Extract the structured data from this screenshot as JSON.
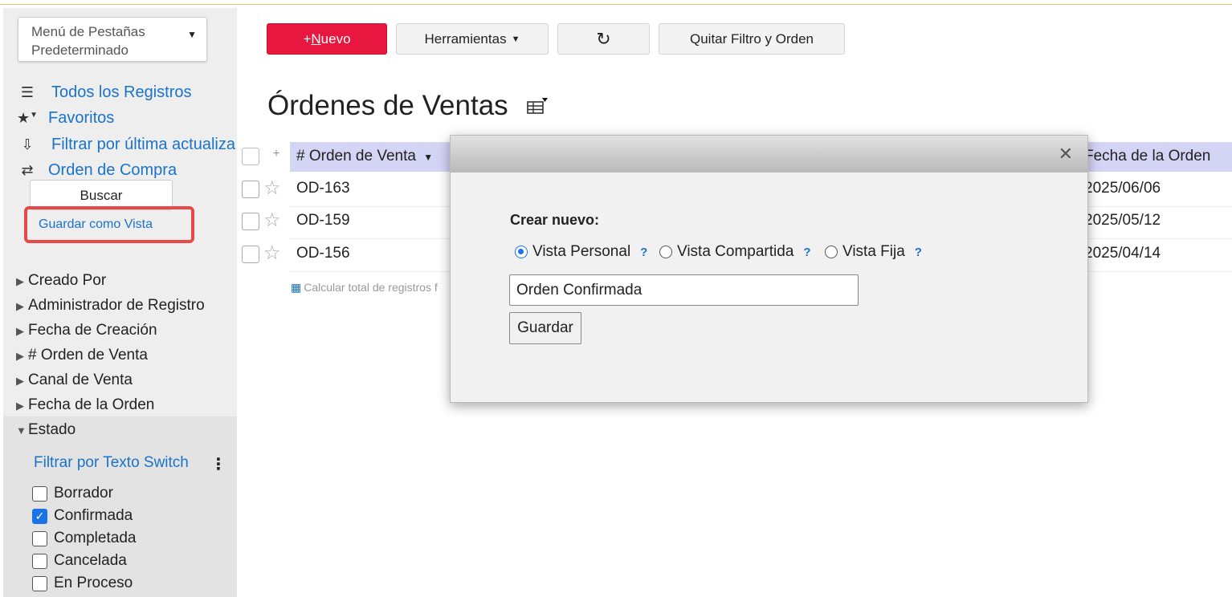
{
  "sidebar": {
    "tab_menu": {
      "line1": "Menú de Pestañas",
      "line2": "Predeterminado"
    },
    "nav": {
      "all_records": "Todos los Registros",
      "favorites": "Favoritos",
      "filter_last_update": "Filtrar por última actualiza",
      "purchase_order": "Orden de Compra"
    },
    "search_button": "Buscar",
    "save_as_view": "Guardar como Vista",
    "facets": [
      "Creado Por",
      "Administrador de Registro",
      "Fecha de Creación",
      "# Orden de Venta",
      "Canal de Venta",
      "Fecha de la Orden"
    ],
    "estado": {
      "label": "Estado",
      "filter_switch": "Filtrar por Texto Switch",
      "options": [
        {
          "label": "Borrador",
          "checked": false
        },
        {
          "label": "Confirmada",
          "checked": true
        },
        {
          "label": "Completada",
          "checked": false
        },
        {
          "label": "Cancelada",
          "checked": false
        },
        {
          "label": "En Proceso",
          "checked": false
        }
      ]
    }
  },
  "toolbar": {
    "new_prefix": "+",
    "new_underlined": "N",
    "new_rest": "uevo",
    "tools": "Herramientas",
    "clear_filter": "Quitar Filtro y Orden"
  },
  "page": {
    "title": "Órdenes de Ventas"
  },
  "table": {
    "col_order": "# Orden de Venta",
    "col_date": "Fecha de la Orden",
    "rows": [
      {
        "id": "OD-163",
        "date": "2025/06/06"
      },
      {
        "id": "OD-159",
        "date": "2025/05/12"
      },
      {
        "id": "OD-156",
        "date": "2025/04/14"
      }
    ],
    "calc_total": "Calcular total de registros f"
  },
  "modal": {
    "create_label": "Crear nuevo:",
    "options": [
      "Vista Personal",
      "Vista Compartida",
      "Vista Fija"
    ],
    "selected": "Vista Personal",
    "help_text": "?",
    "input_value": "Orden Confirmada",
    "save_button": "Guardar"
  },
  "colors": {
    "primary_button": "#e8173f",
    "link": "#1a73c9",
    "header_bg": "#d4d4f5",
    "highlight_border": "#e84848"
  },
  "icons": [
    "list-icon",
    "star-icon",
    "sort-icon",
    "purchase-icon",
    "refresh-icon",
    "table-view-icon",
    "calculator-icon",
    "close-icon"
  ]
}
